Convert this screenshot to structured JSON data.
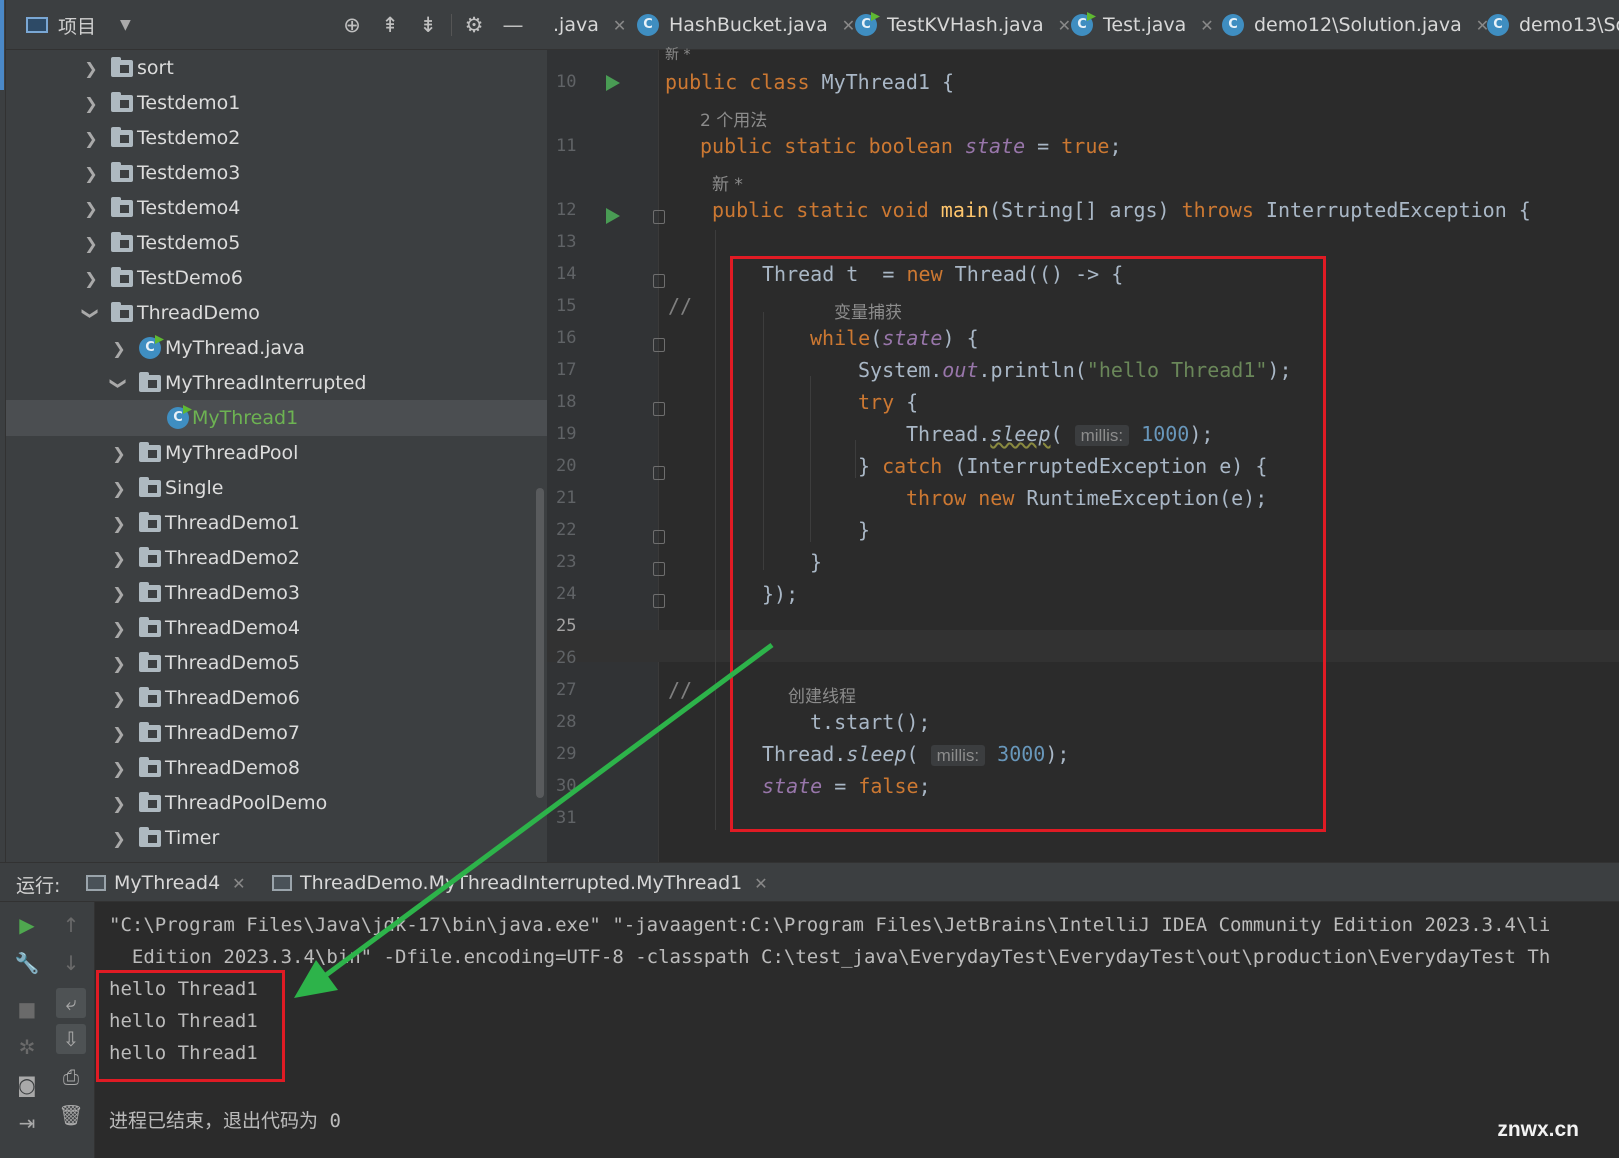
{
  "project_panel": {
    "title": "项目",
    "items": [
      {
        "label": "sort",
        "kind": "folder"
      },
      {
        "label": "Testdemo1",
        "kind": "folder"
      },
      {
        "label": "Testdemo2",
        "kind": "folder"
      },
      {
        "label": "Testdemo3",
        "kind": "folder"
      },
      {
        "label": "Testdemo4",
        "kind": "folder"
      },
      {
        "label": "Testdemo5",
        "kind": "folder"
      },
      {
        "label": "TestDemo6",
        "kind": "folder"
      },
      {
        "label": "ThreadDemo",
        "kind": "folder",
        "expanded": true
      },
      {
        "label": "MyThread.java",
        "kind": "class-file"
      },
      {
        "label": "MyThreadInterrupted",
        "kind": "folder",
        "expanded": true
      },
      {
        "label": "MyThread1",
        "kind": "class",
        "selected": true
      },
      {
        "label": "MyThreadPool",
        "kind": "folder"
      },
      {
        "label": "Single",
        "kind": "folder"
      },
      {
        "label": "ThreadDemo1",
        "kind": "folder"
      },
      {
        "label": "ThreadDemo2",
        "kind": "folder"
      },
      {
        "label": "ThreadDemo3",
        "kind": "folder"
      },
      {
        "label": "ThreadDemo4",
        "kind": "folder"
      },
      {
        "label": "ThreadDemo5",
        "kind": "folder"
      },
      {
        "label": "ThreadDemo6",
        "kind": "folder"
      },
      {
        "label": "ThreadDemo7",
        "kind": "folder"
      },
      {
        "label": "ThreadDemo8",
        "kind": "folder"
      },
      {
        "label": "ThreadPoolDemo",
        "kind": "folder"
      },
      {
        "label": "Timer",
        "kind": "folder"
      }
    ]
  },
  "editor_tabs": [
    {
      "label": ".java"
    },
    {
      "label": "HashBucket.java"
    },
    {
      "label": "TestKVHash.java"
    },
    {
      "label": "Test.java"
    },
    {
      "label": "demo12\\Solution.java"
    },
    {
      "label": "demo13\\Sol"
    }
  ],
  "editor": {
    "line_numbers": [
      "10",
      "11",
      "12",
      "13",
      "14",
      "15",
      "16",
      "17",
      "18",
      "19",
      "20",
      "21",
      "22",
      "23",
      "24",
      "25",
      "26",
      "27",
      "28",
      "29",
      "30",
      "31"
    ],
    "current_line": "25",
    "top_hint": "新 *",
    "usage_hint": "2 个用法",
    "new_hint": "新 *",
    "code": {
      "l10": {
        "kw": "public class",
        "name": "MyThread1",
        "rest": " {"
      },
      "l11": {
        "kw": "public static boolean",
        "field": "state",
        "eq": " = ",
        "val": "true",
        "end": ";"
      },
      "l12": {
        "kw": "public static void",
        "method": "main",
        "params": "(String[] args) ",
        "throws": "throws",
        "exc": " InterruptedException {"
      },
      "l14": {
        "a": "Thread t  = ",
        "kw": "new",
        "b": " Thread(() -> {"
      },
      "l15_comment": "//",
      "l15_inline": "变量捕获",
      "l16": {
        "kw": "while",
        "a": "(",
        "field": "state",
        "b": ") {"
      },
      "l17": {
        "a": "System.",
        "out": "out",
        "b": ".println(",
        "str": "\"hello Thread1\"",
        "c": ");"
      },
      "l18": {
        "kw": "try",
        "a": " {"
      },
      "l19": {
        "a": "Thread.",
        "m": "sleep",
        "b": "(",
        "hint": "millis:",
        "num": "1000",
        "c": ");"
      },
      "l20": {
        "a": "} ",
        "kw": "catch",
        "b": " (InterruptedException e) {"
      },
      "l21": {
        "kw": "throw new",
        "a": " RuntimeException(e);"
      },
      "l22": "}",
      "l23": "}",
      "l24": "});",
      "l27_comment": "//",
      "l27_inline": "创建线程",
      "l28": "t.start();",
      "l29": {
        "a": "Thread.",
        "m": "sleep",
        "b": "(",
        "hint": "millis:",
        "num": "3000",
        "c": ");"
      },
      "l30": {
        "field": "state",
        "a": " = ",
        "kw": "false",
        "b": ";"
      }
    }
  },
  "run_panel": {
    "label": "运行:",
    "tabs": [
      {
        "label": "MyThread4"
      },
      {
        "label": "ThreadDemo.MyThreadInterrupted.MyThread1"
      }
    ],
    "console": {
      "cmd1": "\"C:\\Program Files\\Java\\jdk-17\\bin\\java.exe\" \"-javaagent:C:\\Program Files\\JetBrains\\IntelliJ IDEA Community Edition 2023.3.4\\li",
      "cmd2": "  Edition 2023.3.4\\bin\" -Dfile.encoding=UTF-8 -classpath C:\\test_java\\EverydayTest\\EverydayTest\\out\\production\\EverydayTest Th",
      "output": [
        "hello Thread1",
        "hello Thread1",
        "hello Thread1"
      ],
      "exit": "进程已结束，退出代码为 0"
    }
  },
  "watermark": "znwx.cn",
  "colors": {
    "annotation_red": "#e01b24",
    "annotation_arrow": "#2db34a",
    "keyword": "#cc7832",
    "string": "#6a8759",
    "number": "#6897bb",
    "field": "#9876aa"
  },
  "icons": {
    "toolbar": [
      "locate-icon",
      "expand-all-icon",
      "collapse-all-icon",
      "gear-icon",
      "minimize-icon"
    ],
    "run_toolbar": [
      "run-icon",
      "up-arrow-icon",
      "down-arrow-icon",
      "wrench-icon",
      "stop-icon",
      "soft-wrap-icon",
      "debug-icon",
      "scroll-to-end-icon",
      "camera-icon",
      "print-icon",
      "exit-icon",
      "trash-icon"
    ]
  }
}
